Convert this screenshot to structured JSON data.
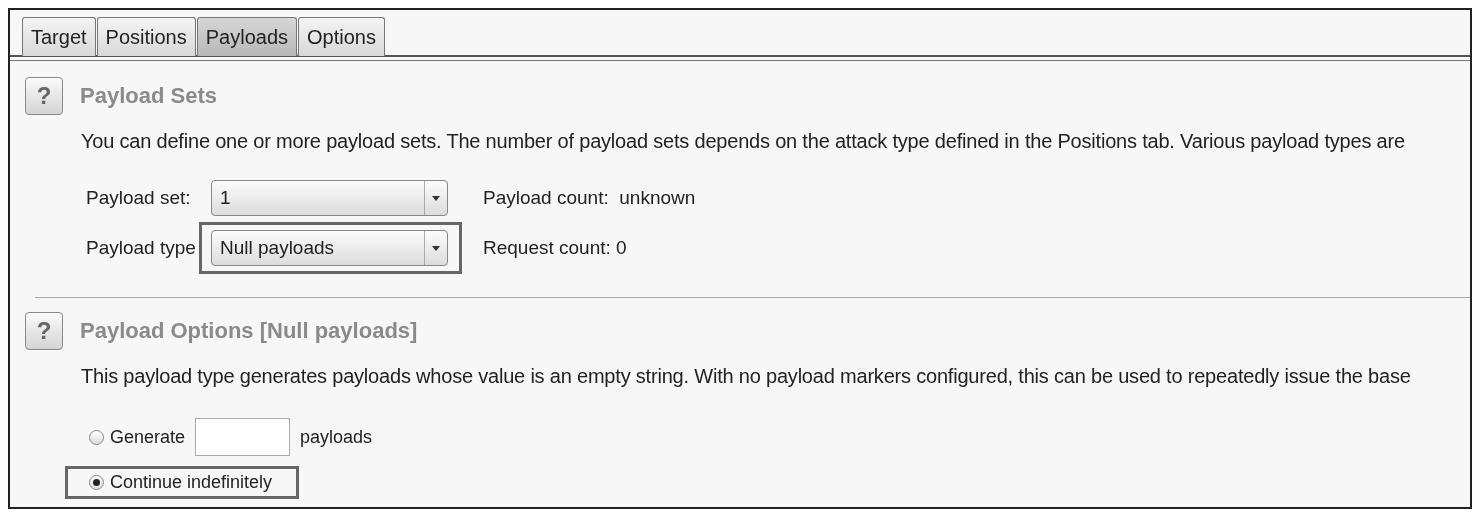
{
  "tabs": [
    {
      "label": "Target",
      "selected": false
    },
    {
      "label": "Positions",
      "selected": false
    },
    {
      "label": "Payloads",
      "selected": true
    },
    {
      "label": "Options",
      "selected": false
    }
  ],
  "sections": [
    {
      "help": "?",
      "title": "Payload Sets",
      "description": "You can define one or more payload sets. The number of payload sets depends on the attack type defined in the Positions tab. Various payload types are",
      "fields": [
        {
          "label": "Payload set:",
          "value": "1",
          "info": "Payload count:  unknown",
          "highlighted": false
        },
        {
          "label": "Payload type",
          "value": "Null payloads",
          "info": "Request count: 0",
          "highlighted": true
        }
      ]
    },
    {
      "help": "?",
      "title": "Payload Options [Null payloads]",
      "description": "This payload type generates payloads whose value is an empty string. With no payload markers configured, this can be used to repeatedly issue the base",
      "options": [
        {
          "kind": "count",
          "label": "Generate",
          "suffix": "payloads",
          "selected": false,
          "highlighted": false
        },
        {
          "kind": "plain",
          "label": "Continue indefinitely",
          "selected": true,
          "highlighted": true
        }
      ]
    }
  ]
}
